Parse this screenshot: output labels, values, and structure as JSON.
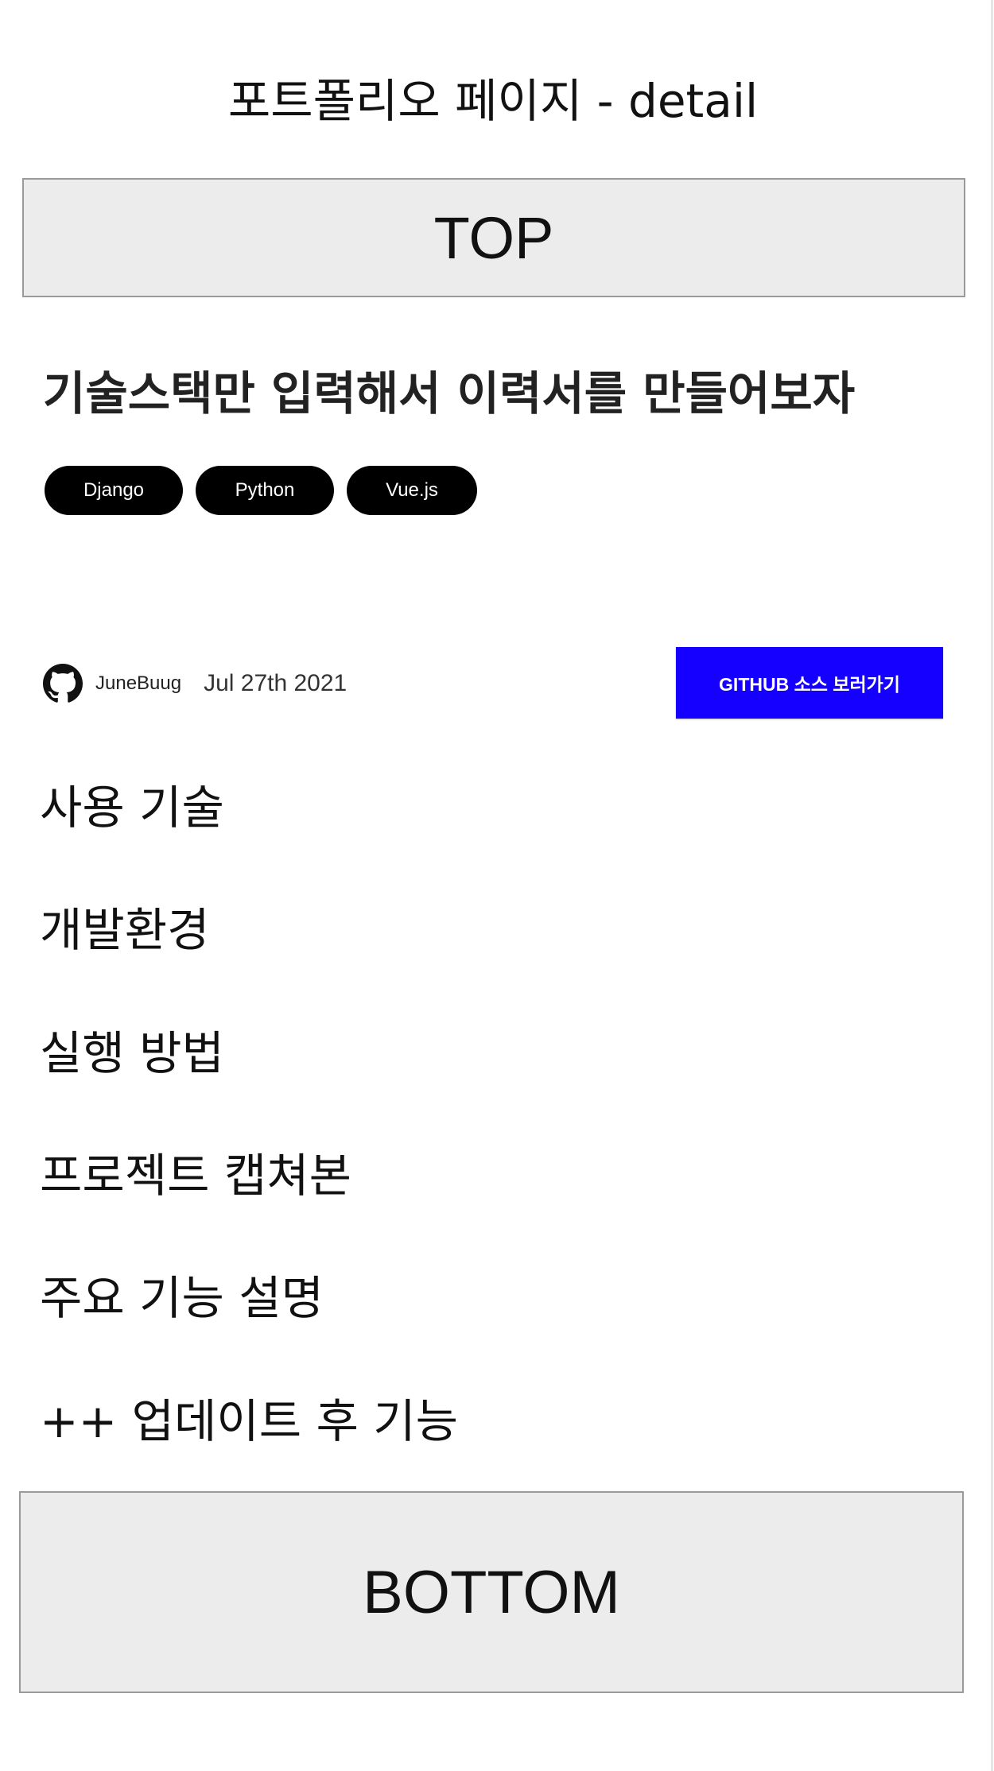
{
  "page": {
    "title": "포트폴리오 페이지 - detail"
  },
  "top_section": {
    "label": "TOP"
  },
  "project": {
    "title": "기술스택만 입력해서 이력서를 만들어보자",
    "tags": [
      "Django",
      "Python",
      "Vue.js"
    ],
    "author": "JuneBuug",
    "date": "Jul 27th 2021",
    "github_button_label": "GITHUB 소스 보러가기"
  },
  "sections": [
    "사용 기술",
    "개발환경",
    "실행 방법",
    "프로젝트 캡쳐본",
    "주요 기능 설명",
    "++ 업데이트 후 기능"
  ],
  "bottom_section": {
    "label": "BOTTOM"
  },
  "colors": {
    "github_button": "#1500ff",
    "tag_bg": "#000000",
    "placeholder_box": "#ececec"
  },
  "icons": {
    "author": "github-icon"
  }
}
